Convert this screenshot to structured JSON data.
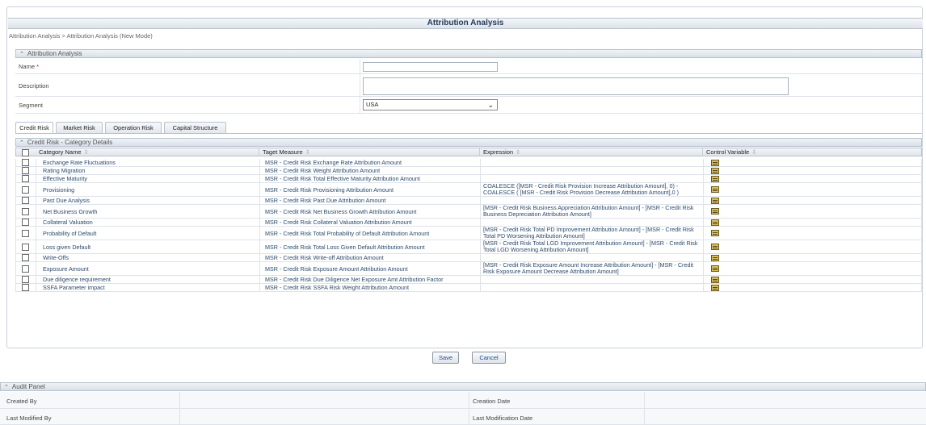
{
  "page": {
    "title": "Attribution Analysis",
    "breadcrumb": "Attribution Analysis > Attribution Analysis (New Mode)"
  },
  "form_section": {
    "header": "Attribution Analysis",
    "name_label": "Name",
    "name_required": "*",
    "name_value": "",
    "description_label": "Description",
    "description_value": "",
    "segment_label": "Segment",
    "segment_value": "USA"
  },
  "tabs": [
    {
      "label": "Credit Risk",
      "active": true
    },
    {
      "label": "Market Risk",
      "active": false
    },
    {
      "label": "Operation Risk",
      "active": false
    },
    {
      "label": "Capital Structure",
      "active": false
    }
  ],
  "grid": {
    "header": "Credit Risk - Category Details",
    "columns": {
      "category": "Category Name",
      "measure": "Taget Measure",
      "expression": "Expression",
      "control": "Control Variable"
    },
    "rows": [
      {
        "category": "Exchange Rate Fluctuations",
        "measure": "MSR - Credit Risk Exchange Rate Attribution Amount",
        "expression": ""
      },
      {
        "category": "Rating Migration",
        "measure": "MSR - Credit Risk Weight Attribution Amount",
        "expression": ""
      },
      {
        "category": "Effective Maturity",
        "measure": "MSR - Credit Risk Total Effective Maturity Attribution Amount",
        "expression": ""
      },
      {
        "category": "Provisioning",
        "measure": "MSR - Credit Risk Provisioning Attribution Amount",
        "expression": "COALESCE ([MSR - Credit Risk Provision Increase Attribution Amount], 0) - COALESCE ( [MSR - Credit Risk Provision Decrease Attribution Amount],0 )"
      },
      {
        "category": "Past Due Analysis",
        "measure": "MSR - Credit Risk Past Due Attribution Amount",
        "expression": ""
      },
      {
        "category": "Net Business Growth",
        "measure": "MSR - Credit Risk Net Business Growth Attribution Amount",
        "expression": "[MSR - Credit Risk Business Appreciation Attribution Amount] - [MSR - Credit Risk Business Depreciation Attribution Amount]"
      },
      {
        "category": "Collateral Valuation",
        "measure": "MSR - Credit Risk Collateral Valuation Attribution Amount",
        "expression": ""
      },
      {
        "category": "Probability of Default",
        "measure": "MSR - Credit Risk Total Probability of Default Attribution Amount",
        "expression": "[MSR - Credit Risk Total PD Improvement Attribution Amount] - [MSR - Credit Risk Total PD Worsening Attribution Amount]"
      },
      {
        "category": "Loss given Default",
        "measure": "MSR - Credit Risk Total Loss Given Default Attribution Amount",
        "expression": "[MSR - Credit Risk Total LGD Improvement Attribution Amount] - [MSR - Credit Risk Total LGD Worsening Attribution Amount]"
      },
      {
        "category": "Write-Offs",
        "measure": "MSR - Credit Risk Write-off Attribution Amount",
        "expression": ""
      },
      {
        "category": "Exposure Amount",
        "measure": "MSR - Credit Risk Exposure Amount Attribution Amount",
        "expression": "[MSR - Credit Risk Exposure Amount Increase Attribution Amount] - [MSR - Credit Risk Exposure Amount Decrease Attribution Amount]"
      },
      {
        "category": "Due diligence requirement",
        "measure": "MSR - Credit Risk Due Diligence Net Exposure Amt Attribution Factor",
        "expression": ""
      },
      {
        "category": "SSFA Parameter impact",
        "measure": "MSR - Credit Risk SSFA Risk Weight Attribution Amount",
        "expression": ""
      }
    ]
  },
  "buttons": {
    "save": "Save",
    "cancel": "Cancel"
  },
  "audit": {
    "header": "Audit Panel",
    "created_by_label": "Created By",
    "creation_date_label": "Creation Date",
    "last_modified_by_label": "Last Modified By",
    "last_modification_date_label": "Last Modification Date"
  },
  "icons": {
    "collapse": "chevron-up-icon",
    "control_variable": "list-icon",
    "sort": "sort-icon"
  }
}
